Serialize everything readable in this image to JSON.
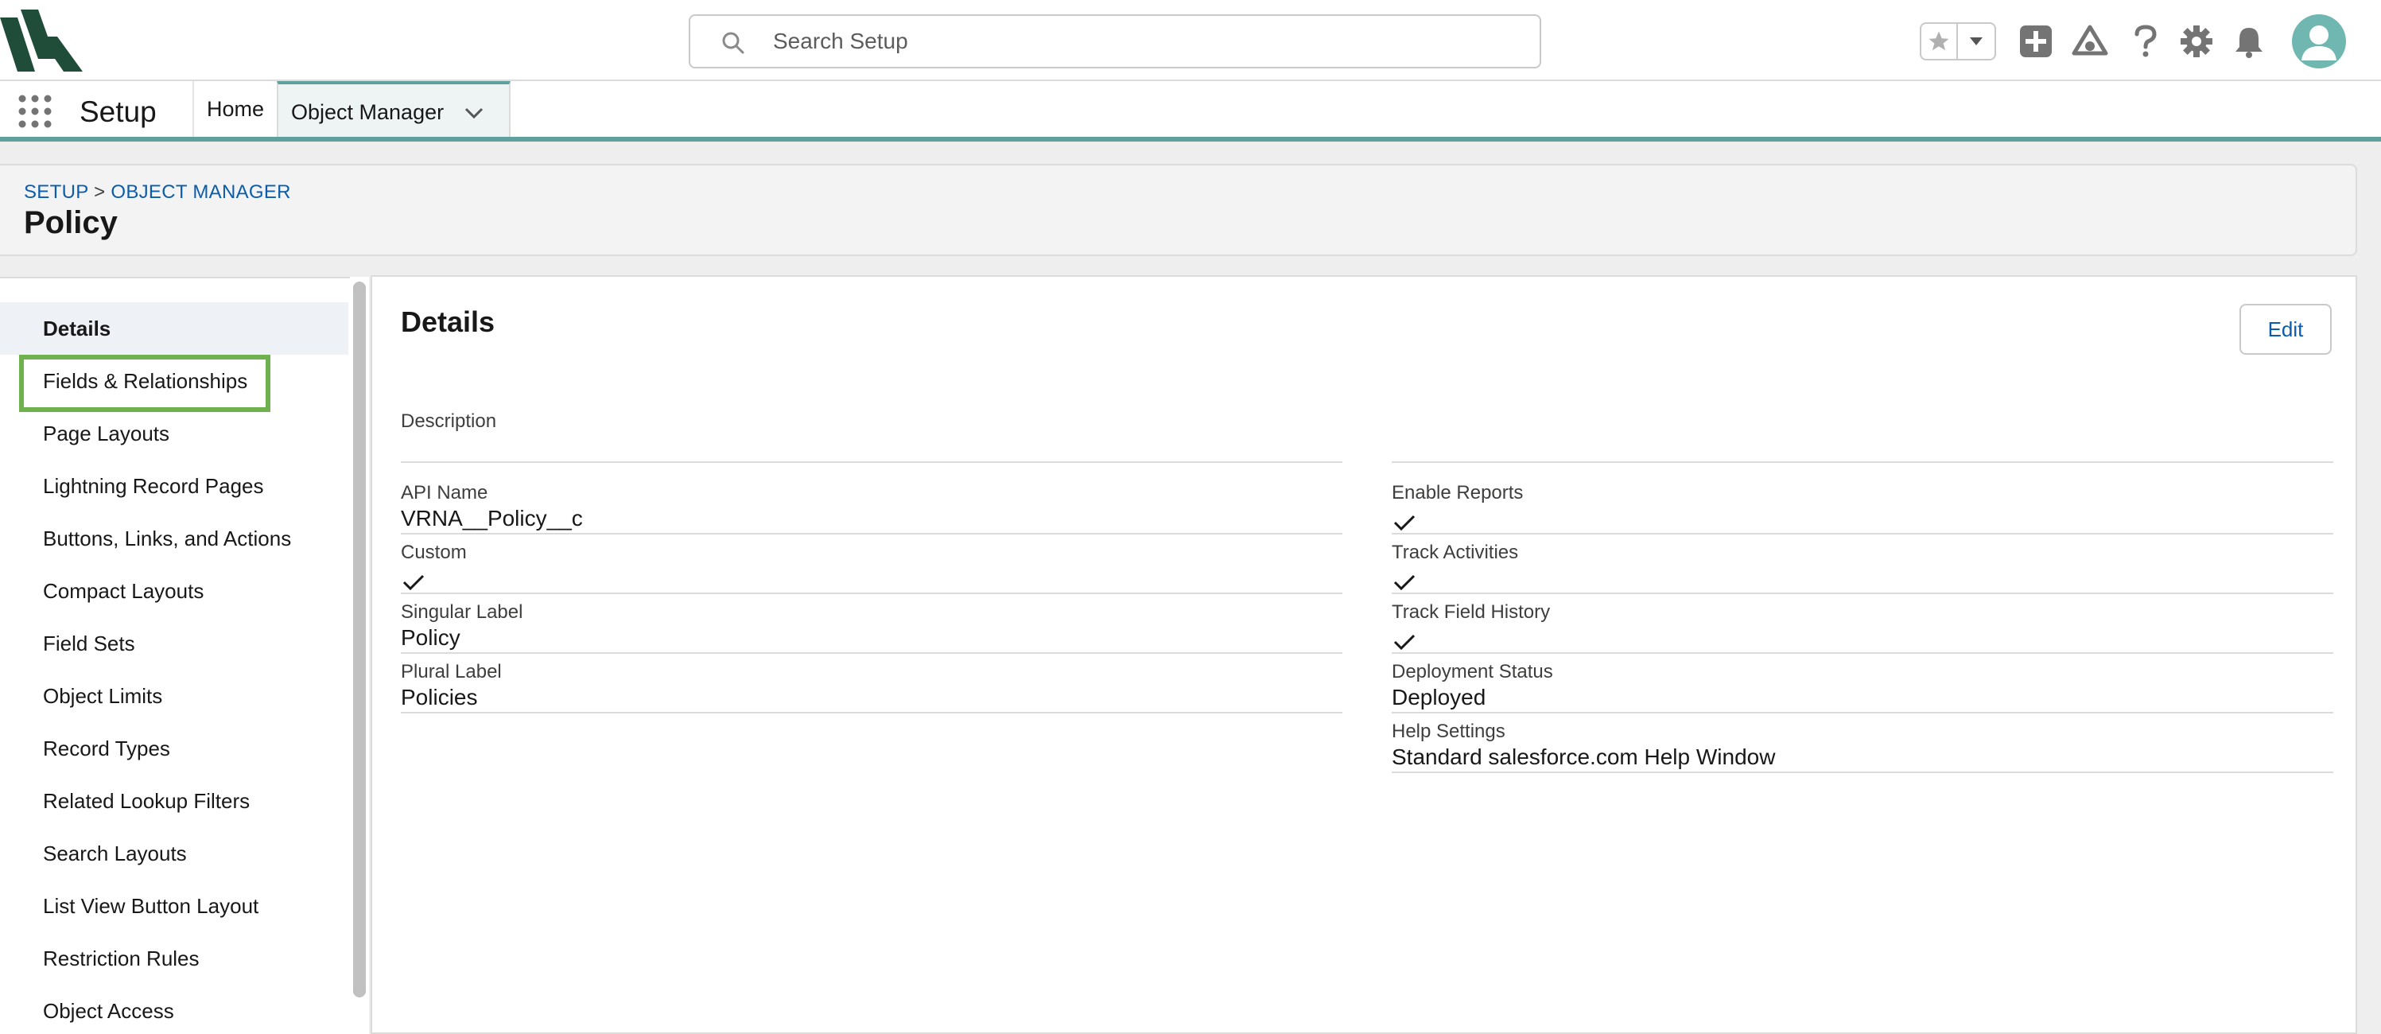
{
  "header": {
    "search": {
      "placeholder": "Search Setup",
      "value": ""
    }
  },
  "nav": {
    "app_name": "Setup",
    "home_label": "Home",
    "object_manager_label": "Object Manager"
  },
  "page": {
    "breadcrumb": {
      "setup": "SETUP",
      "separator": ">",
      "object_manager": "OBJECT MANAGER"
    },
    "title": "Policy"
  },
  "sidebar": {
    "items": [
      {
        "label": "Details",
        "active": true
      },
      {
        "label": "Fields & Relationships",
        "focused": true
      },
      {
        "label": "Page Layouts"
      },
      {
        "label": "Lightning Record Pages"
      },
      {
        "label": "Buttons, Links, and Actions"
      },
      {
        "label": "Compact Layouts"
      },
      {
        "label": "Field Sets"
      },
      {
        "label": "Object Limits"
      },
      {
        "label": "Record Types"
      },
      {
        "label": "Related Lookup Filters"
      },
      {
        "label": "Search Layouts"
      },
      {
        "label": "List View Button Layout"
      },
      {
        "label": "Restriction Rules"
      },
      {
        "label": "Object Access"
      }
    ]
  },
  "details": {
    "title": "Details",
    "edit_label": "Edit",
    "description_label": "Description",
    "description_value": "",
    "left": [
      {
        "label": "API Name",
        "value": "VRNA__Policy__c"
      },
      {
        "label": "Custom",
        "checked": true
      },
      {
        "label": "Singular Label",
        "value": "Policy"
      },
      {
        "label": "Plural Label",
        "value": "Policies"
      }
    ],
    "right": [
      {
        "label": "Enable Reports",
        "checked": true
      },
      {
        "label": "Track Activities",
        "checked": true
      },
      {
        "label": "Track Field History",
        "checked": true
      },
      {
        "label": "Deployment Status",
        "value": "Deployed"
      },
      {
        "label": "Help Settings",
        "value": "Standard salesforce.com Help Window"
      }
    ]
  },
  "colors": {
    "accent_teal": "#5f9f9e",
    "link_blue": "#0b5cab",
    "focus_green": "#6fb14f",
    "logo_dark_green": "#1f4d3a"
  },
  "icons": [
    "brand-logo-icon",
    "search-icon",
    "favorite-star-icon",
    "chevron-down-icon",
    "add-icon",
    "trailhead-icon",
    "help-icon",
    "gear-icon",
    "bell-icon",
    "user-avatar-icon",
    "app-launcher-icon",
    "checkmark-icon"
  ]
}
